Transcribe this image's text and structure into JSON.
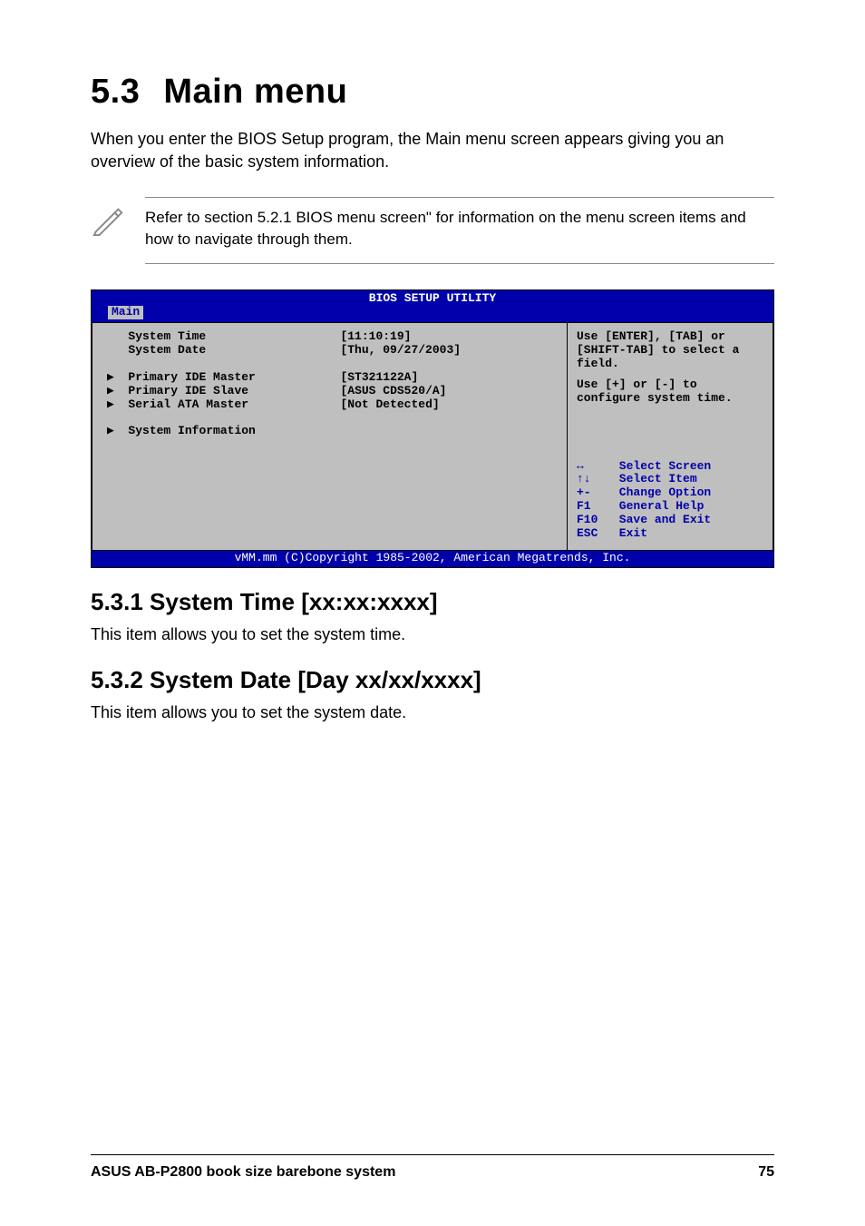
{
  "heading": {
    "number": "5.3",
    "title": "Main menu"
  },
  "intro": "When you enter the BIOS Setup program, the Main menu screen appears giving you an overview of the basic system information.",
  "note": "Refer to section 5.2.1 BIOS menu screen\" for information on the menu screen items and how to navigate through them.",
  "bios": {
    "title": "BIOS SETUP UTILITY",
    "tab": "Main",
    "left": {
      "items": [
        {
          "label": "System Time",
          "value": "[11:10:19]",
          "submenu": false
        },
        {
          "label": "System Date",
          "value": "[Thu, 09/27/2003]",
          "submenu": false
        },
        {
          "spacer": true
        },
        {
          "label": "Primary IDE Master",
          "value": "[ST321122A]",
          "submenu": true
        },
        {
          "label": "Primary IDE Slave",
          "value": "[ASUS CDS520/A]",
          "submenu": true
        },
        {
          "label": "Serial ATA Master",
          "value": "[Not Detected]",
          "submenu": true
        },
        {
          "spacer": true
        },
        {
          "label": "System Information",
          "value": "",
          "submenu": true
        }
      ]
    },
    "right": {
      "help1": "Use [ENTER], [TAB] or [SHIFT-TAB] to select a field.",
      "help2": "Use [+] or [-] to configure system time.",
      "nav": [
        {
          "key": "↔",
          "text": "Select Screen"
        },
        {
          "key": "↑↓",
          "text": "Select Item"
        },
        {
          "key": "+-",
          "text": "Change Option"
        },
        {
          "key": "F1",
          "text": "General Help"
        },
        {
          "key": "F10",
          "text": "Save and Exit"
        },
        {
          "key": "ESC",
          "text": "Exit"
        }
      ]
    },
    "footer": "vMM.mm (C)Copyright 1985-2002, American Megatrends, Inc."
  },
  "sections": [
    {
      "heading": "5.3.1  System Time [xx:xx:xxxx]",
      "body": "This item allows you to set the system time."
    },
    {
      "heading": "5.3.2  System Date [Day xx/xx/xxxx]",
      "body": "This item allows you to set the system date."
    }
  ],
  "footer": {
    "left": "ASUS AB-P2800 book size barebone system",
    "right": "75"
  }
}
